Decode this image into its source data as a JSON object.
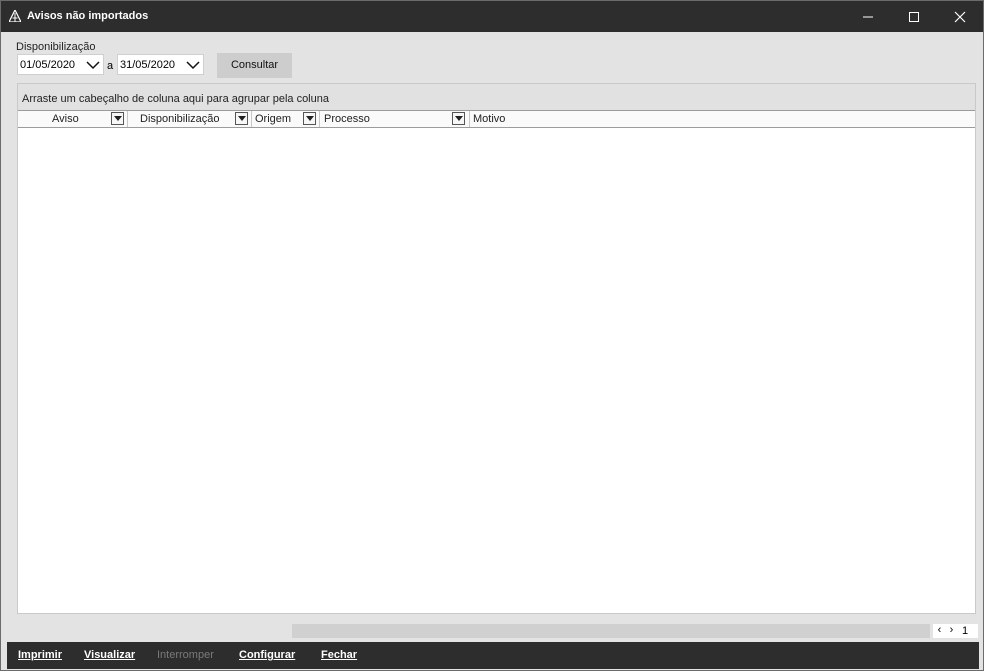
{
  "window": {
    "title": "Avisos não importados",
    "icon": "app-logo-icon"
  },
  "filter": {
    "label": "Disponibilização",
    "date_from": "01/05/2020",
    "separator": "a",
    "date_to": "31/05/2020",
    "consult_button": "Consultar"
  },
  "grid": {
    "group_hint": "Arraste um cabeçalho de coluna aqui para agrupar pela coluna",
    "columns": [
      "Aviso",
      "Disponibilização",
      "Origem",
      "Processo",
      "Motivo"
    ],
    "rows": []
  },
  "pager": {
    "page": "1"
  },
  "bottom": {
    "print": "Imprimir",
    "view": "Visualizar",
    "interrupt": "Interromper",
    "configure": "Configurar",
    "close": "Fechar"
  }
}
